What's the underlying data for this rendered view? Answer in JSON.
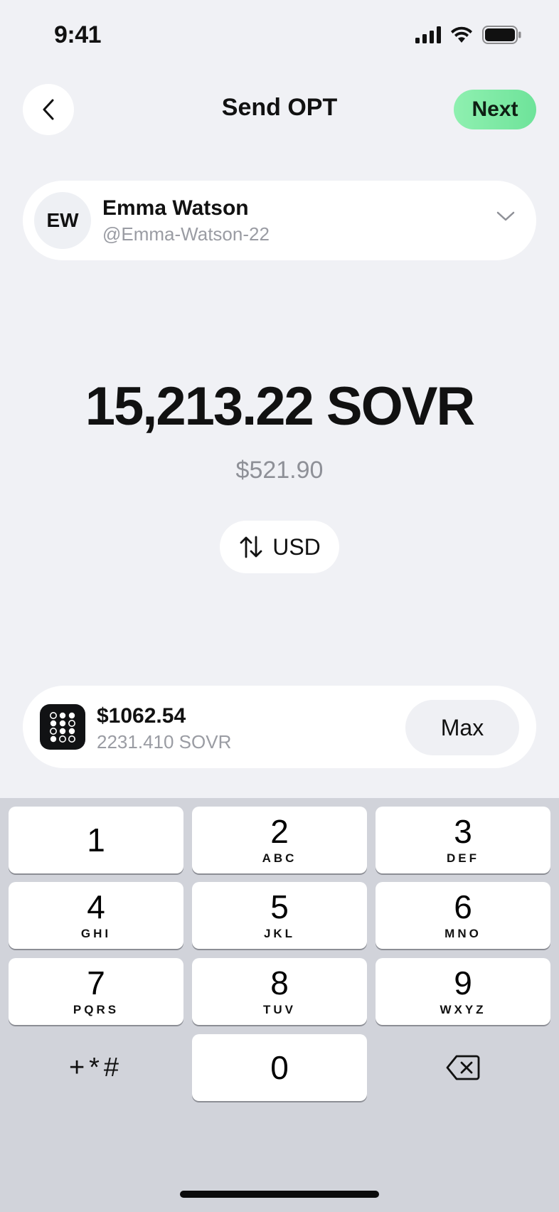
{
  "status_bar": {
    "time": "9:41"
  },
  "header": {
    "title": "Send OPT",
    "next_label": "Next"
  },
  "recipient": {
    "initials": "EW",
    "name": "Emma Watson",
    "handle": "@Emma-Watson-22"
  },
  "amount": {
    "value": "15,213.22 SOVR",
    "fiat": "$521.90",
    "toggle_label": "USD"
  },
  "balance": {
    "fiat": "$1062.54",
    "token": "2231.410 SOVR",
    "max_label": "Max"
  },
  "keypad": {
    "keys": [
      {
        "digit": "1",
        "letters": ""
      },
      {
        "digit": "2",
        "letters": "ABC"
      },
      {
        "digit": "3",
        "letters": "DEF"
      },
      {
        "digit": "4",
        "letters": "GHI"
      },
      {
        "digit": "5",
        "letters": "JKL"
      },
      {
        "digit": "6",
        "letters": "MNO"
      },
      {
        "digit": "7",
        "letters": "PQRS"
      },
      {
        "digit": "8",
        "letters": "TUV"
      },
      {
        "digit": "9",
        "letters": "WXYZ"
      },
      {
        "digit": "0",
        "letters": ""
      }
    ],
    "symbols_label": "+*#"
  },
  "colors": {
    "accent": "#7ee8a4",
    "background": "#f0f1f5",
    "keypad_bg": "#d1d3da"
  }
}
